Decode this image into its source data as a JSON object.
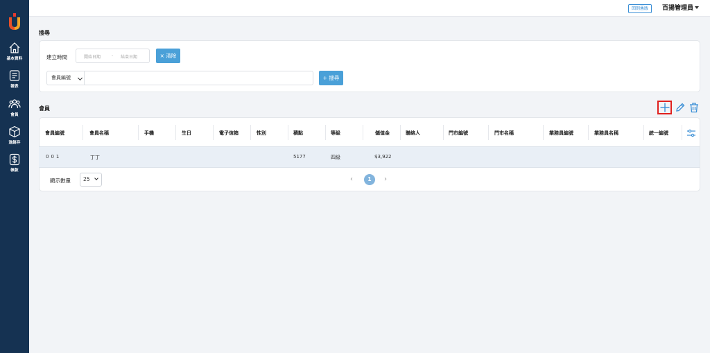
{
  "brand": {
    "accent": "#4aa0d8",
    "sidebar_bg": "#153252",
    "highlight": "#e0201e"
  },
  "sidebar": {
    "items": [
      {
        "label": "基本資料",
        "icon": "home-icon"
      },
      {
        "label": "報表",
        "icon": "report-icon"
      },
      {
        "label": "會員",
        "icon": "members-icon"
      },
      {
        "label": "進銷存",
        "icon": "inventory-icon"
      },
      {
        "label": "帳款",
        "icon": "dollar-icon"
      }
    ]
  },
  "topbar": {
    "back_label": "回到舊版",
    "user_label": "百揚管理員"
  },
  "search": {
    "section_title": "搜尋",
    "created_label": "建立時間",
    "start_placeholder": "開始日期",
    "range_sep": "-",
    "end_placeholder": "結束日期",
    "clear_label": "× 清除",
    "field_select": "會員編號",
    "search_label": "+ 搜尋"
  },
  "members": {
    "section_title": "會員",
    "columns": [
      "會員編號",
      "會員名稱",
      "手機",
      "生日",
      "電子信箱",
      "性別",
      "積點",
      "等級",
      "儲值金",
      "聯絡人",
      "門市編號",
      "門市名稱",
      "業務員編號",
      "業務員名稱",
      "統一編號"
    ],
    "rows": [
      {
        "id": "001",
        "name": "丁丁",
        "phone": "",
        "birthday": "",
        "email": "",
        "gender": "",
        "points": "5177",
        "level": "四級",
        "balance": "$3,922",
        "contact": "",
        "store_id": "",
        "store_name": "",
        "sales_id": "",
        "sales_name": "",
        "tax_id": ""
      }
    ],
    "page_size_label": "顯示數量",
    "page_size": "25",
    "current_page": "1"
  }
}
